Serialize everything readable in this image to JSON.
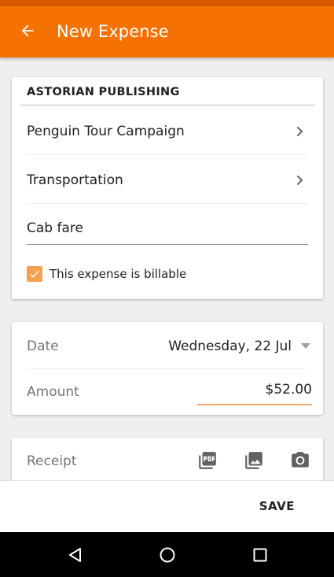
{
  "app_bar": {
    "title": "New Expense",
    "back_icon": "arrow-left-icon",
    "background": "#f57200"
  },
  "details_card": {
    "company": "ASTORIAN PUBLISHING",
    "project": "Penguin Tour Campaign",
    "category": "Transportation",
    "description_value": "Cab fare",
    "billable_checked": true,
    "billable_label": "This expense is billable"
  },
  "info_card": {
    "date_label": "Date",
    "date_value": "Wednesday, 22 Jul",
    "amount_label": "Amount",
    "amount_value": "$52.00"
  },
  "receipt_card": {
    "label": "Receipt",
    "icons": [
      "pdf-icon",
      "image-icon",
      "camera-icon"
    ]
  },
  "bottom_bar": {
    "save_label": "SAVE"
  },
  "nav_bar": {
    "icons": [
      "back-triangle-icon",
      "home-circle-icon",
      "recents-square-icon"
    ]
  },
  "colors": {
    "accent": "#f57200",
    "checkbox": "#f6a054",
    "amount_underline": "#f7a96a"
  }
}
